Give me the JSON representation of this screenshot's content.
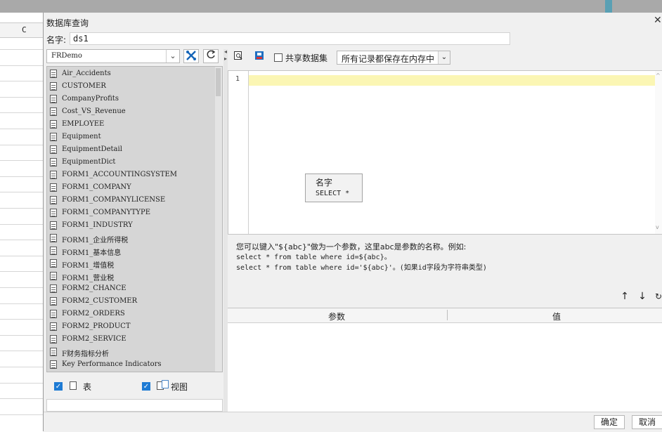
{
  "sheet": {
    "column_c": "C"
  },
  "dialog": {
    "title": "数据库查询",
    "name_label": "名字:",
    "name_value": "ds1",
    "datasource": "FRDemo",
    "tables": [
      "Air_Accidents",
      "CUSTOMER",
      "CompanyProfits",
      "Cost_VS_Revenue",
      "EMPLOYEE",
      "Equipment",
      "EquipmentDetail",
      "EquipmentDict",
      "FORM1_ACCOUNTINGSYSTEM",
      "FORM1_COMPANY",
      "FORM1_COMPANYLICENSE",
      "FORM1_COMPANYTYPE",
      "FORM1_INDUSTRY",
      "FORM1_企业所得税",
      "FORM1_基本信息",
      "FORM1_增值税",
      "FORM1_营业税",
      "FORM2_CHANCE",
      "FORM2_CUSTOMER",
      "FORM2_ORDERS",
      "FORM2_PRODUCT",
      "FORM2_SERVICE",
      "F财务指标分析",
      "Key Performance Indicators"
    ],
    "filter": {
      "table_label": "表",
      "view_label": "视图"
    },
    "toolbar": {
      "share_label": "共享数据集",
      "memory_option": "所有记录都保存在内存中"
    },
    "editor": {
      "line_number": "1",
      "autocomplete": {
        "title": "名字",
        "item": "SELECT *"
      }
    },
    "help": {
      "line1": "您可以键入\"${abc}\"做为一个参数，这里abc是参数的名称。例如:",
      "line2": "select * from table where id=${abc}。",
      "line3": "select * from table where id='${abc}'。(如果id字段为字符串类型)"
    },
    "params": {
      "col_param": "参数",
      "col_value": "值"
    },
    "buttons": {
      "ok": "确定",
      "cancel": "取消"
    }
  }
}
